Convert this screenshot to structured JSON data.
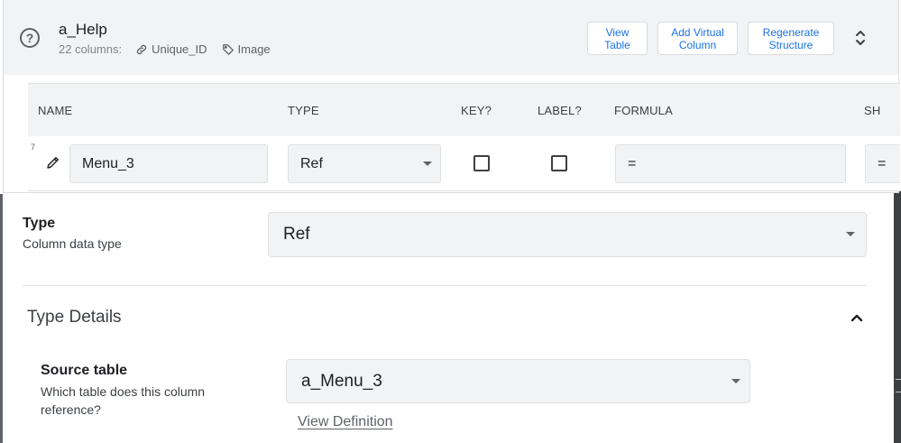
{
  "header": {
    "title": "a_Help",
    "column_count": "22 columns:",
    "key_column": "Unique_ID",
    "label_column": "Image",
    "buttons": {
      "view_table": "View\nTable",
      "add_virtual_column": "Add Virtual\nColumn",
      "regenerate_structure": "Regenerate\nStructure"
    }
  },
  "column_table": {
    "headers": [
      "NAME",
      "TYPE",
      "KEY?",
      "LABEL?",
      "FORMULA",
      "SH"
    ],
    "row": {
      "index": "7",
      "name": "Menu_3",
      "type": "Ref",
      "key": false,
      "label": false,
      "formula": "=",
      "show": "="
    }
  },
  "detail": {
    "type_title": "Type",
    "type_desc": "Column data type",
    "type_value": "Ref",
    "type_details_title": "Type Details",
    "source_table_title": "Source table",
    "source_table_desc": "Which table does this column reference?",
    "source_table_value": "a_Menu_3",
    "view_definition_link": "View Definition"
  },
  "colors": {
    "accent": "#1a73e8",
    "header_bg": "#f1f3f4",
    "field_bg": "#f1f3f4",
    "text": "#202124"
  }
}
